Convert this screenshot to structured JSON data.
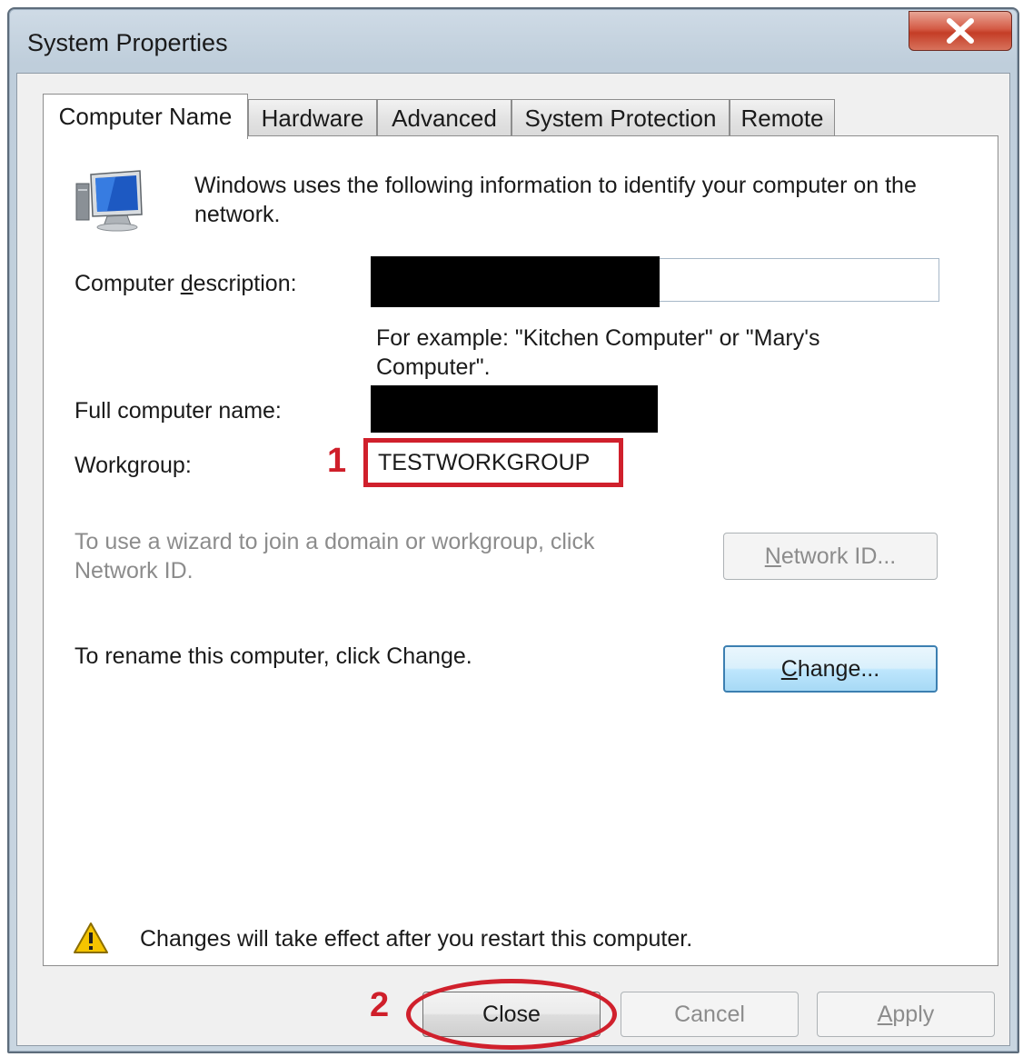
{
  "window": {
    "title": "System Properties",
    "close_glyph": "X"
  },
  "tabs": [
    {
      "label": "Computer Name",
      "active": true
    },
    {
      "label": "Hardware",
      "active": false
    },
    {
      "label": "Advanced",
      "active": false
    },
    {
      "label": "System Protection",
      "active": false
    },
    {
      "label": "Remote",
      "active": false
    }
  ],
  "computer_name": {
    "intro": "Windows uses the following information to identify your computer on the network.",
    "description_label_pre": "Computer ",
    "description_label_accel": "d",
    "description_label_post": "escription:",
    "description_value": "",
    "example_text": "For example: \"Kitchen Computer\" or \"Mary's Computer\".",
    "full_name_label": "Full computer name:",
    "full_name_value": "",
    "workgroup_label": "Workgroup:",
    "workgroup_value": "TESTWORKGROUP",
    "wizard_text": "To use a wizard to join a domain or workgroup, click Network ID.",
    "network_id_accel": "N",
    "network_id_rest": "etwork ID...",
    "rename_text": "To rename this computer, click Change.",
    "change_accel": "C",
    "change_rest": "hange...",
    "restart_notice": "Changes will take effect after you restart this computer."
  },
  "annotations": {
    "step1": "1",
    "step2": "2",
    "color": "#d0202c"
  },
  "footer": {
    "close_label": "Close",
    "cancel_label": "Cancel",
    "apply_accel": "A",
    "apply_rest": "pply"
  },
  "icons": {
    "computer": "monitor-icon",
    "warning": "warning-icon",
    "close": "close-icon"
  }
}
